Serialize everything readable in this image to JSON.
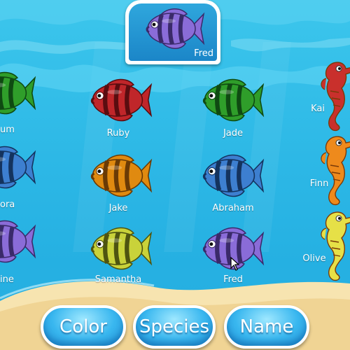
{
  "top_card": {
    "name": "Fred",
    "color": "#8a6cd8"
  },
  "fish": [
    {
      "id": "ruby",
      "name": "Ruby",
      "color": "#c0262a",
      "stripe": "#5a0d10"
    },
    {
      "id": "jade",
      "name": "Jade",
      "color": "#2f9e2a",
      "stripe": "#0f4a12"
    },
    {
      "id": "jake",
      "name": "Jake",
      "color": "#e08a10",
      "stripe": "#6a3a05"
    },
    {
      "id": "abraham",
      "name": "Abraham",
      "color": "#3d7fd0",
      "stripe": "#14335e"
    },
    {
      "id": "samantha",
      "name": "Samantha",
      "color": "#c9d23a",
      "stripe": "#4e5410"
    },
    {
      "id": "fred",
      "name": "Fred",
      "color": "#8a6cd8",
      "stripe": "#3a2a6a"
    }
  ],
  "left_fish": [
    {
      "id": "left-green",
      "label": "um",
      "color": "#2f9e2a",
      "stripe": "#0f4a12"
    },
    {
      "id": "left-blue",
      "label": "ora",
      "color": "#3d7fd0",
      "stripe": "#14335e"
    },
    {
      "id": "left-purple",
      "label": "ine",
      "color": "#8a6cd8",
      "stripe": "#3a2a6a"
    }
  ],
  "seahorses": [
    {
      "id": "kai",
      "name": "Kai",
      "color": "#c9302c"
    },
    {
      "id": "finn",
      "name": "Finn",
      "color": "#ee8a1c"
    },
    {
      "id": "olive",
      "name": "Olive",
      "color": "#e6e047"
    }
  ],
  "buttons": {
    "color": "Color",
    "species": "Species",
    "name": "Name"
  },
  "colors": {
    "water": "#2db8e6",
    "sand": "#f3dca0",
    "button": "#39b7ef"
  }
}
